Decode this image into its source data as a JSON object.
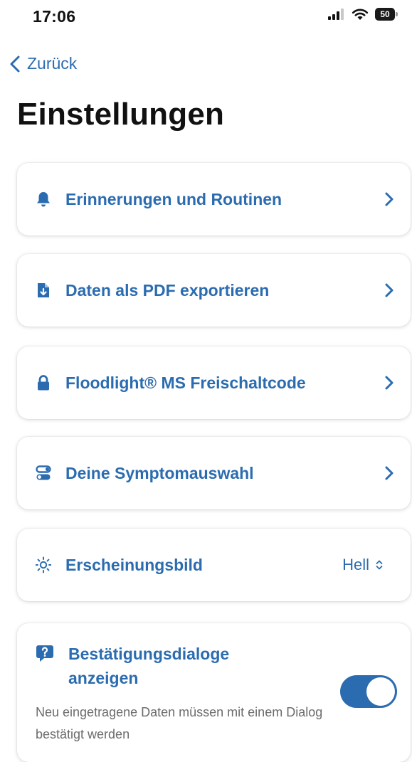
{
  "status_bar": {
    "time": "17:06",
    "battery": "50"
  },
  "nav": {
    "back_label": "Zurück"
  },
  "page": {
    "title": "Einstellungen"
  },
  "settings": {
    "items": [
      {
        "label": "Erinnerungen und Routinen",
        "icon": "bell-icon"
      },
      {
        "label": "Daten als PDF exportieren",
        "icon": "pdf-export-icon"
      },
      {
        "label": "Floodlight® MS Freischaltcode",
        "icon": "lock-icon"
      },
      {
        "label": "Deine Symptomauswahl",
        "icon": "symptom-selection-icon"
      }
    ],
    "appearance": {
      "label": "Erscheinungsbild",
      "value": "Hell",
      "icon": "sun-icon"
    },
    "confirm_dialogs": {
      "title": "Bestätigungsdialoge anzeigen",
      "description": "Neu eingetragene Daten müssen mit einem Dialog bestätigt werden",
      "enabled": true,
      "icon": "question-bubble-icon"
    }
  },
  "colors": {
    "accent": "#2b6cb0",
    "secondary_text": "#6b6b6b"
  }
}
